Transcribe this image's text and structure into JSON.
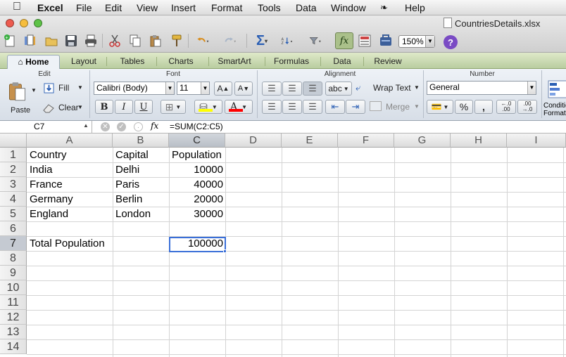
{
  "menubar": {
    "app_name": "Excel",
    "items": [
      "File",
      "Edit",
      "View",
      "Insert",
      "Format",
      "Tools",
      "Data",
      "Window",
      "Help"
    ]
  },
  "window": {
    "title": "CountriesDetails.xlsx",
    "zoom": "150%"
  },
  "ribbon_tabs": [
    "Home",
    "Layout",
    "Tables",
    "Charts",
    "SmartArt",
    "Formulas",
    "Data",
    "Review"
  ],
  "ribbon": {
    "groups": {
      "edit": "Edit",
      "font": "Font",
      "alignment": "Alignment",
      "number": "Number"
    },
    "paste_label": "Paste",
    "fill_label": "Fill",
    "clear_label": "Clear",
    "font_name": "Calibri (Body)",
    "font_size": "11",
    "font_grow": "A",
    "font_shrink": "A",
    "bold": "B",
    "italic": "I",
    "underline": "U",
    "font_color_letter": "A",
    "abc_label": "abc",
    "wrap_text_label": "Wrap Text",
    "merge_label": "Merge",
    "number_format": "General",
    "percent": "%",
    "comma": ",",
    "inc_decimal": "←.0 .00",
    "dec_decimal": ".00 →.0",
    "conditional_formatting": "Conditional Formatting",
    "colors": {
      "fill_color": "#ffff00",
      "font_color": "#ff0000"
    }
  },
  "formula_bar": {
    "name_box": "C7",
    "fx_label": "fx",
    "formula": "=SUM(C2:C5)"
  },
  "sheet": {
    "columns": [
      "A",
      "B",
      "C",
      "D",
      "E",
      "F",
      "G",
      "H",
      "I"
    ],
    "selected_column": "C",
    "selected_row": "7",
    "rows": [
      "1",
      "2",
      "3",
      "4",
      "5",
      "6",
      "7",
      "8",
      "9",
      "10",
      "11",
      "12",
      "13",
      "14"
    ],
    "cells": {
      "a1": "Country",
      "b1": "Capital",
      "c1": "Population",
      "a2": "India",
      "b2": "Delhi",
      "c2": "10000",
      "a3": "France",
      "b3": "Paris",
      "c3": "40000",
      "a4": "Germany",
      "b4": "Berlin",
      "c4": "20000",
      "a5": "England",
      "b5": "London",
      "c5": "30000",
      "a7": "Total Population",
      "c7": "100000"
    }
  }
}
